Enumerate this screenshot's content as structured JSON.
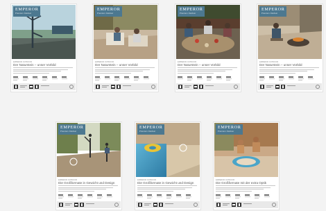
{
  "brand": {
    "logo": "EMPEROR",
    "logo_sub": "Premium Outdoor"
  },
  "posters": [
    {
      "kicker": "EMPEROR OUTDOOR",
      "headline": "Der Naturstein – unser Vorbild",
      "photo": "yoga-pier"
    },
    {
      "kicker": "EMPEROR OUTDOOR",
      "headline": "Der Naturstein – unser Vorbild",
      "photo": "terrace-family"
    },
    {
      "kicker": "EMPEROR OUTDOOR",
      "headline": "Der Naturstein – unser Vorbild",
      "photo": "dinner-table"
    },
    {
      "kicker": "EMPEROR OUTDOOR",
      "headline": "Der Naturstein – unser Vorbild",
      "photo": "fire-pit"
    },
    {
      "kicker": "EMPEROR OUTDOOR",
      "headline": "Die Großformate in Gewicht und Design",
      "photo": "garden-play"
    },
    {
      "kicker": "EMPEROR OUTDOOR",
      "headline": "Die Großformate in Gewicht und Design",
      "photo": "pool-float"
    },
    {
      "kicker": "EMPEROR OUTDOOR",
      "headline": "Die Großformate mit der extra Optik",
      "photo": "pool-kids"
    }
  ]
}
